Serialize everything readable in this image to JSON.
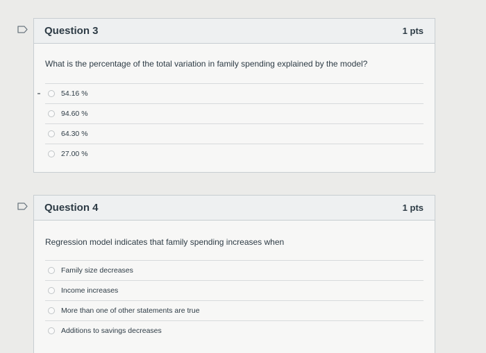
{
  "questions": [
    {
      "title": "Question 3",
      "points": "1 pts",
      "text": "What is the percentage of the total variation in family spending explained by the model?",
      "answers": [
        {
          "label": "54.16 %"
        },
        {
          "label": "94.60 %"
        },
        {
          "label": "64.30 %"
        },
        {
          "label": "27.00 %"
        }
      ]
    },
    {
      "title": "Question 4",
      "points": "1 pts",
      "text": "Regression model indicates that family spending increases when",
      "answers": [
        {
          "label": "Family size decreases"
        },
        {
          "label": "Income increases"
        },
        {
          "label": "More than one of other statements are true"
        },
        {
          "label": "Additions to savings decreases"
        }
      ]
    }
  ],
  "icons": {
    "flag": "flag-icon",
    "radio": "radio-button-icon"
  },
  "colors": {
    "header_bg": "#eef0f1",
    "border": "#c7cdd1",
    "text": "#2d3b45"
  }
}
